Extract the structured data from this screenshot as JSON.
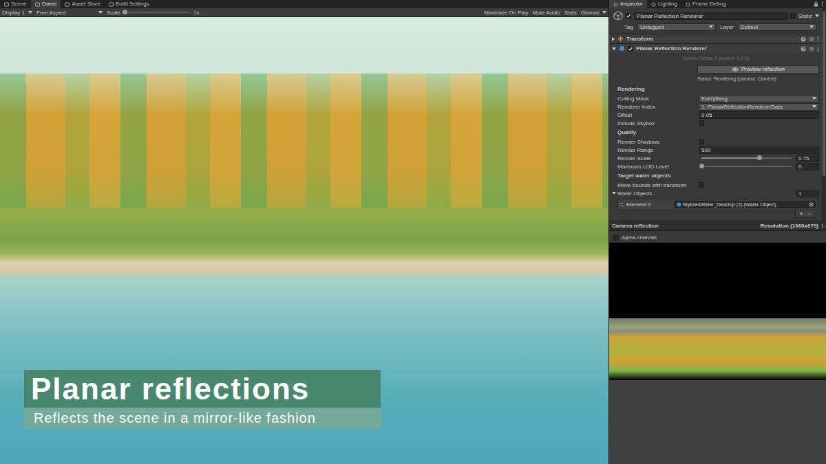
{
  "editor_tabs": [
    {
      "label": "Scene",
      "selected": false
    },
    {
      "label": "Game",
      "selected": true
    },
    {
      "label": "Asset Store",
      "selected": false
    },
    {
      "label": "Build Settings",
      "selected": false
    }
  ],
  "toolbar": {
    "display": "Display 1",
    "aspect": "Free Aspect",
    "scale_label": "Scale",
    "scale_value": "1x",
    "scale_level": 0,
    "toggles": [
      {
        "label": "Maximize On Play",
        "on": false,
        "kind": "button"
      },
      {
        "label": "Mute Audio",
        "on": false,
        "kind": "button"
      },
      {
        "label": "Stats",
        "on": false,
        "kind": "button"
      },
      {
        "label": "Gizmos",
        "on": false,
        "kind": "dropdown"
      }
    ]
  },
  "game_view": {
    "caption": {
      "title": "Planar reflections",
      "subtitle": "Reflects the scene in a mirror-like fashion"
    }
  },
  "inspector": {
    "tabs": [
      {
        "label": "Inspector",
        "selected": true
      },
      {
        "label": "Lighting",
        "selected": false
      },
      {
        "label": "Frame Debug",
        "selected": false
      }
    ],
    "object": {
      "name": "Planar Reflection Renderer",
      "active": true,
      "static_label": "Static",
      "static": false,
      "tag_label": "Tag",
      "tag": "Untagged",
      "layer_label": "Layer",
      "layer": "Default"
    },
    "components": [
      {
        "name": "Transform",
        "kind": "plain",
        "expanded": false,
        "enabled": true
      },
      {
        "name": "Planar Reflection Renderer",
        "kind": "toggle",
        "expanded": true,
        "enabled": true
      }
    ],
    "version": "Stylized Water 2 (version 1.4.0)",
    "preview_button": "Preview reflection",
    "status": "Status: Rendering (camera: Camera)",
    "sections": [
      {
        "title": "Rendering",
        "fields": [
          {
            "kind": "dropdown",
            "label": "Culling Mask",
            "value": "Everything"
          },
          {
            "kind": "dropdown",
            "label": "Renderer Index",
            "value": "1: PlanarReflectionRendererData"
          },
          {
            "kind": "number",
            "label": "Offset",
            "value": "0.05"
          },
          {
            "kind": "checkbox",
            "label": "Include Skybox",
            "checked": false
          }
        ]
      },
      {
        "title": "Quality",
        "fields": [
          {
            "kind": "checkbox",
            "label": "Render Shadows",
            "checked": false
          },
          {
            "kind": "number",
            "label": "Render Range",
            "value": "500"
          },
          {
            "kind": "slider",
            "label": "Render Scale",
            "value": "0.75",
            "level": 0.64
          },
          {
            "kind": "slider",
            "label": "Maximum LOD Level",
            "value": "0",
            "level": 0
          }
        ]
      },
      {
        "title": "Target water objects",
        "fields": [
          {
            "kind": "checkbox",
            "label": "Move bounds with transform",
            "checked": false
          }
        ]
      }
    ],
    "water_objects": {
      "label": "Water Objects",
      "count": "1",
      "expanded": true,
      "items": [
        {
          "label": "Element 0",
          "value": "StylizedWater_Desktop (2) (Water Object)"
        }
      ],
      "add": "+",
      "remove": "−"
    },
    "preview": {
      "title": "Camera reflection",
      "resolution": "Resolution (1060x679)",
      "alpha_label": "Alpha channel",
      "alpha": false
    }
  }
}
